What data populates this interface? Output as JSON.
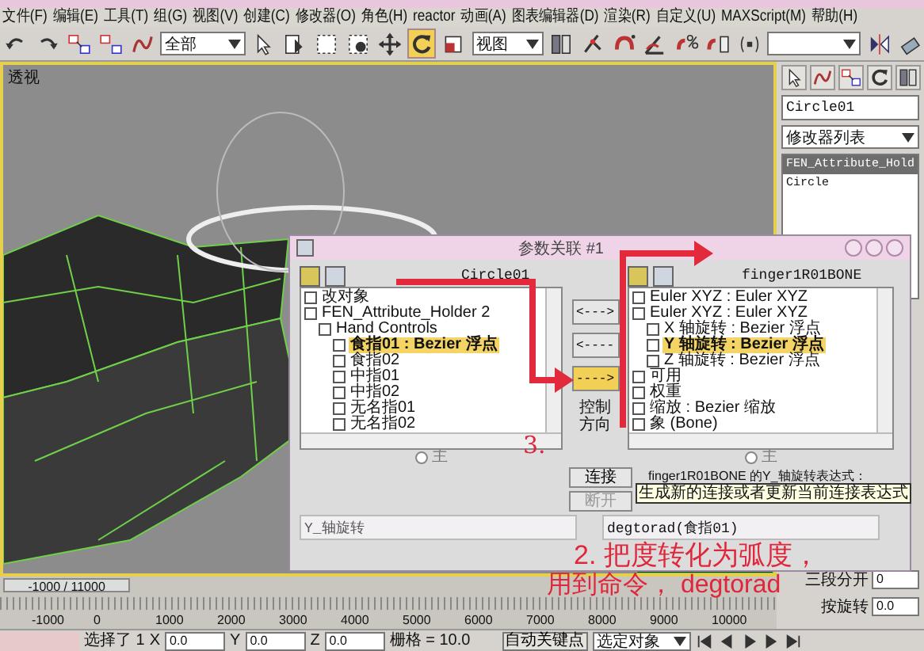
{
  "menu": [
    "文件(F)",
    "编辑(E)",
    "工具(T)",
    "组(G)",
    "视图(V)",
    "创建(C)",
    "修改器(O)",
    "角色(H)",
    "reactor",
    "动画(A)",
    "图表编辑器(D)",
    "渲染(R)",
    "自定义(U)",
    "MAXScript(M)",
    "帮助(H)"
  ],
  "toolbar": {
    "tools": [
      {
        "kind": "undo",
        "selected": false
      },
      {
        "kind": "redo",
        "selected": false
      },
      {
        "kind": "link",
        "selected": false
      },
      {
        "kind": "unlink",
        "selected": false
      },
      {
        "kind": "bind",
        "selected": false
      },
      {
        "kind": "filter"
      },
      {
        "kind": "select",
        "selected": false
      },
      {
        "kind": "select-list",
        "selected": false
      },
      {
        "kind": "rect-select",
        "selected": false
      },
      {
        "kind": "window-select",
        "selected": false
      },
      {
        "kind": "move",
        "selected": false
      },
      {
        "kind": "rotate",
        "selected": true
      },
      {
        "kind": "scale",
        "selected": false
      },
      {
        "kind": "coords"
      },
      {
        "kind": "pivot",
        "selected": false
      },
      {
        "kind": "manipulate",
        "selected": false
      },
      {
        "kind": "snap",
        "selected": false
      },
      {
        "kind": "angle-snap",
        "selected": false
      },
      {
        "kind": "percent-snap",
        "selected": false
      },
      {
        "kind": "spinner-snap",
        "selected": false
      },
      {
        "kind": "named-selection",
        "selected": false
      },
      {
        "kind": "named-list"
      },
      {
        "kind": "mirror",
        "selected": false
      },
      {
        "kind": "align",
        "selected": false
      }
    ],
    "selection_filter": "全部",
    "coordinate_system": "视图"
  },
  "viewport": {
    "label": "透视"
  },
  "command_panel": {
    "object_name": "Circle01",
    "modifier_list": "修改器列表",
    "stack": [
      {
        "label": "FEN_Attribute_Hold",
        "selected": true
      },
      {
        "label": "Circle",
        "selected": false
      }
    ],
    "rows": [
      {
        "label": "三段分开",
        "value": "0"
      },
      {
        "label": "按旋转",
        "value": "0.0"
      }
    ]
  },
  "dialog": {
    "title": "参数关联 #1",
    "left": {
      "title": "Circle01",
      "items": [
        {
          "label": "改对象",
          "selected": false
        },
        {
          "label": "FEN_Attribute_Holder 2",
          "selected": false,
          "children": [
            {
              "label": "Hand Controls",
              "selected": false,
              "children": [
                {
                  "label": "食指01 : Bezier 浮点",
                  "selected": true
                },
                {
                  "label": "食指02",
                  "selected": false
                },
                {
                  "label": "中指01",
                  "selected": false
                },
                {
                  "label": "中指02",
                  "selected": false
                },
                {
                  "label": "无名指01",
                  "selected": false
                },
                {
                  "label": "无名指02",
                  "selected": false
                }
              ]
            }
          ]
        }
      ]
    },
    "right": {
      "title": "finger1R01BONE",
      "items": [
        {
          "label": "Euler XYZ : Euler XYZ",
          "selected": false
        },
        {
          "label": "Euler XYZ : Euler XYZ",
          "selected": false,
          "children": [
            {
              "label": "X 轴旋转 : Bezier 浮点",
              "selected": false
            },
            {
              "label": "Y 轴旋转 : Bezier 浮点",
              "selected": true
            },
            {
              "label": "Z 轴旋转 : Bezier 浮点",
              "selected": false
            }
          ]
        },
        {
          "label": "可用",
          "selected": false
        },
        {
          "label": "权重",
          "selected": false
        },
        {
          "label": "缩放 : Bezier 缩放",
          "selected": false
        },
        {
          "label": "象 (Bone)",
          "selected": false
        }
      ]
    },
    "direction_buttons": [
      {
        "label": "<--->",
        "selected": false
      },
      {
        "label": "<----",
        "selected": false
      },
      {
        "label": "---->",
        "selected": true
      }
    ],
    "direction_label": "控制方向",
    "master_radios": [
      {
        "label": "主",
        "selected": false
      },
      {
        "label": "主",
        "selected": false
      }
    ],
    "connect_button": "连接",
    "disconnect_button": "断开",
    "tooltip": "生成新的连接或者更新当前连接表达式",
    "expression_label": "finger1R01BONE 的Y_轴旋转表达式：",
    "left_expression": "Y_轴旋转",
    "right_expression": "degtorad(食指01)"
  },
  "annotations": [
    "3.",
    "2. 把度转化为弧度，",
    "用到命令， degtorad"
  ],
  "timeline": {
    "range": "-1000 / 11000",
    "ticks": [
      "-1000",
      "0",
      "1000",
      "2000",
      "3000",
      "4000",
      "5000",
      "6000",
      "7000",
      "8000",
      "9000",
      "10000"
    ]
  },
  "status_bar": {
    "selection": "选择了 1",
    "coords": [
      {
        "axis": "X",
        "value": "0.0"
      },
      {
        "axis": "Y",
        "value": "0.0"
      },
      {
        "axis": "Z",
        "value": "0.0"
      }
    ],
    "grid": "栅格 = 10.0",
    "auto_key": "自动关键点",
    "key_filter": "选定对象"
  }
}
